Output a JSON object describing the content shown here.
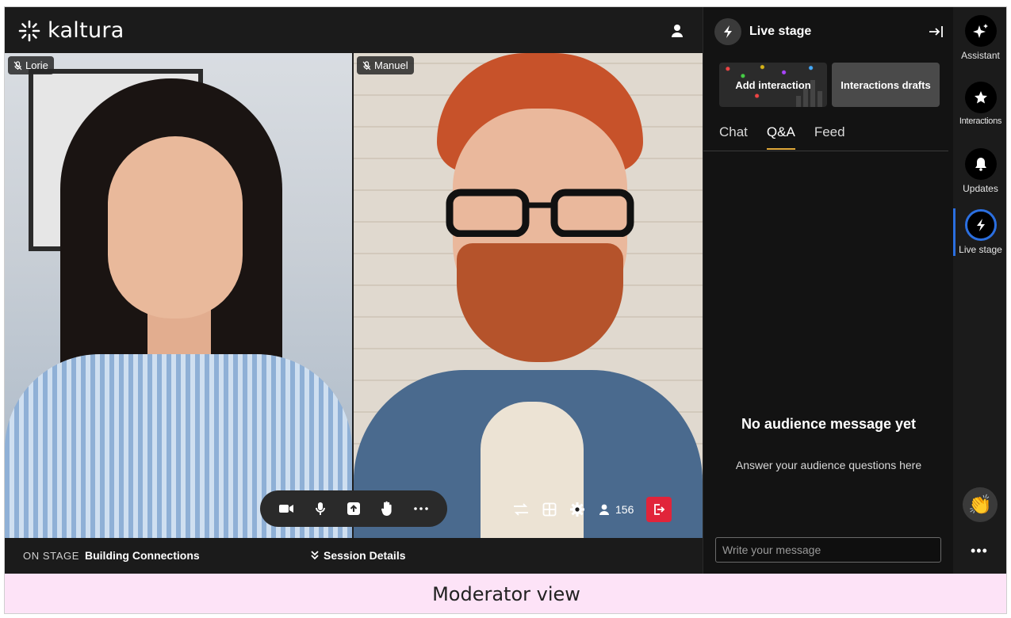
{
  "app": {
    "logo_text": "kaltura"
  },
  "participants": [
    {
      "name": "Lorie",
      "muted": true
    },
    {
      "name": "Manuel",
      "muted": true
    }
  ],
  "controls": {
    "attendee_count": "156",
    "icons": [
      "camera-icon",
      "microphone-icon",
      "share-screen-icon",
      "raise-hand-icon",
      "more-icon",
      "switch-icon",
      "layout-grid-icon",
      "settings-icon",
      "attendees-icon",
      "leave-icon"
    ]
  },
  "bottom_bar": {
    "on_stage_label": "ON STAGE",
    "stage_title": "Building Connections",
    "session_details_label": "Session Details"
  },
  "panel": {
    "title": "Live stage",
    "add_interaction_label": "Add interaction",
    "interaction_drafts_label": "Interactions drafts",
    "tabs": [
      {
        "label": "Chat",
        "active": false
      },
      {
        "label": "Q&A",
        "active": true
      },
      {
        "label": "Feed",
        "active": false
      }
    ],
    "empty_title": "No audience message yet",
    "empty_subtitle": "Answer your audience questions here",
    "message_placeholder": "Write your message"
  },
  "rail": {
    "items": [
      {
        "label": "Assistant"
      },
      {
        "label": "Interactions"
      },
      {
        "label": "Updates"
      },
      {
        "label": "Live stage",
        "active": true
      }
    ],
    "more_label": "•••"
  },
  "caption": "Moderator view",
  "colors": {
    "accent_tab": "#e0a83a",
    "active_rail": "#2b6fe0",
    "leave": "#e1243a"
  }
}
